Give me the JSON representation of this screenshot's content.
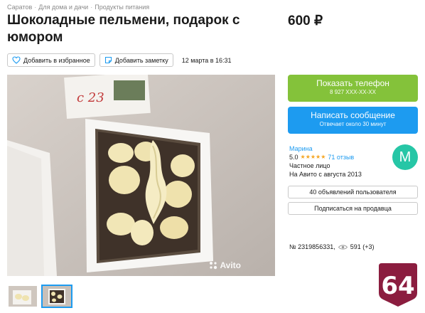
{
  "breadcrumbs": [
    "Саратов",
    "Для дома и дачи",
    "Продукты питания"
  ],
  "title": "Шоколадные пельмени, подарок с юмором",
  "price": "600 ₽",
  "actions": {
    "favorite_label": "Добавить в избранное",
    "note_label": "Добавить заметку",
    "date": "12 марта в 16:31"
  },
  "photo": {
    "watermark": "Avito"
  },
  "contact": {
    "phone_label": "Показать телефон",
    "phone_number": "8 927 XXX-XX-XX",
    "message_label": "Написать сообщение",
    "message_sub": "Отвечает около 30 минут"
  },
  "seller": {
    "name": "Марина",
    "rating": "5.0",
    "stars": "★★★★★",
    "reviews": "71 отзыв",
    "type": "Частное лицо",
    "since": "На Авито с августа 2013",
    "avatar_letter": "М",
    "ads_label": "40 объявлений пользователя",
    "subscribe_label": "Подписаться на продавца"
  },
  "stats": {
    "ad_number": "№ 2319856331,",
    "views": "591 (+3)"
  },
  "badge": {
    "text": "64",
    "color": "#8b1d3f"
  },
  "colors": {
    "phone_button": "#84c23a",
    "message_button": "#1d9bf0",
    "link": "#1d9bf0",
    "avatar": "#26c6a6"
  }
}
